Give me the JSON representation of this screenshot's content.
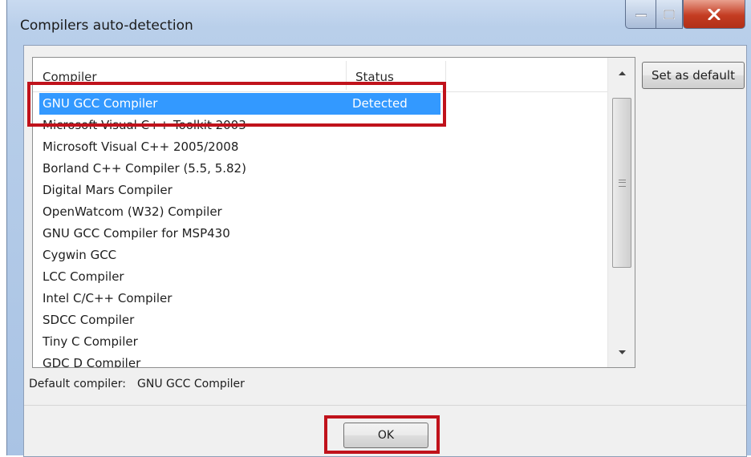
{
  "window": {
    "title": "Compilers auto-detection"
  },
  "list": {
    "columns": [
      "Compiler",
      "Status"
    ],
    "rows": [
      {
        "name": "GNU GCC Compiler",
        "status": "Detected",
        "selected": true
      },
      {
        "name": "Microsoft Visual C++ Toolkit 2003",
        "status": ""
      },
      {
        "name": "Microsoft Visual C++ 2005/2008",
        "status": ""
      },
      {
        "name": "Borland C++ Compiler (5.5, 5.82)",
        "status": ""
      },
      {
        "name": "Digital Mars Compiler",
        "status": ""
      },
      {
        "name": "OpenWatcom (W32) Compiler",
        "status": ""
      },
      {
        "name": "GNU GCC Compiler for MSP430",
        "status": ""
      },
      {
        "name": "Cygwin GCC",
        "status": ""
      },
      {
        "name": "LCC Compiler",
        "status": ""
      },
      {
        "name": "Intel C/C++ Compiler",
        "status": ""
      },
      {
        "name": "SDCC Compiler",
        "status": ""
      },
      {
        "name": "Tiny C Compiler",
        "status": ""
      },
      {
        "name": "GDC D Compiler",
        "status": ""
      }
    ]
  },
  "buttons": {
    "set_default": "Set as default",
    "ok": "OK"
  },
  "default_compiler": {
    "label": "Default compiler:",
    "value": "GNU GCC Compiler"
  },
  "colors": {
    "selection": "#3399ff",
    "highlight_box": "#c0121b",
    "close_button": "#c43c22"
  }
}
